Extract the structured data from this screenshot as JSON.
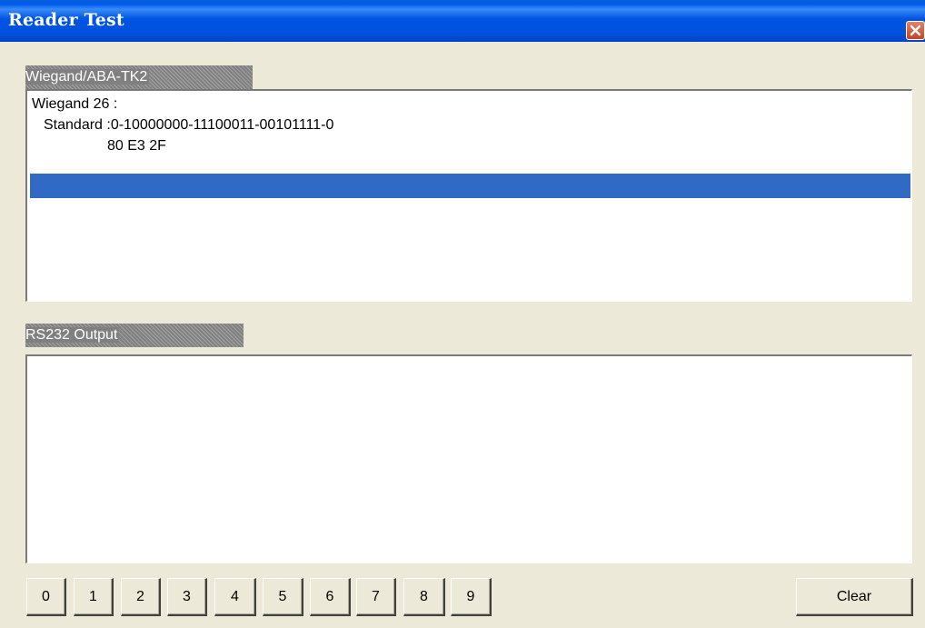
{
  "window": {
    "title": "Reader Test",
    "close_icon": "close-icon",
    "close_color": "#d0502c"
  },
  "wiegand": {
    "header": "Wiegand/ABA-TK2",
    "lines": [
      "Wiegand 26 :",
      "Standard :0-10000000-11100011-00101111-0",
      "80 E3 2F"
    ],
    "selected_color": "#316ac5"
  },
  "rs232": {
    "header": "RS232 Output",
    "lines": []
  },
  "keypad": {
    "buttons": [
      "0",
      "1",
      "2",
      "3",
      "4",
      "5",
      "6",
      "7",
      "8",
      "9"
    ],
    "clear_label": "Clear"
  }
}
